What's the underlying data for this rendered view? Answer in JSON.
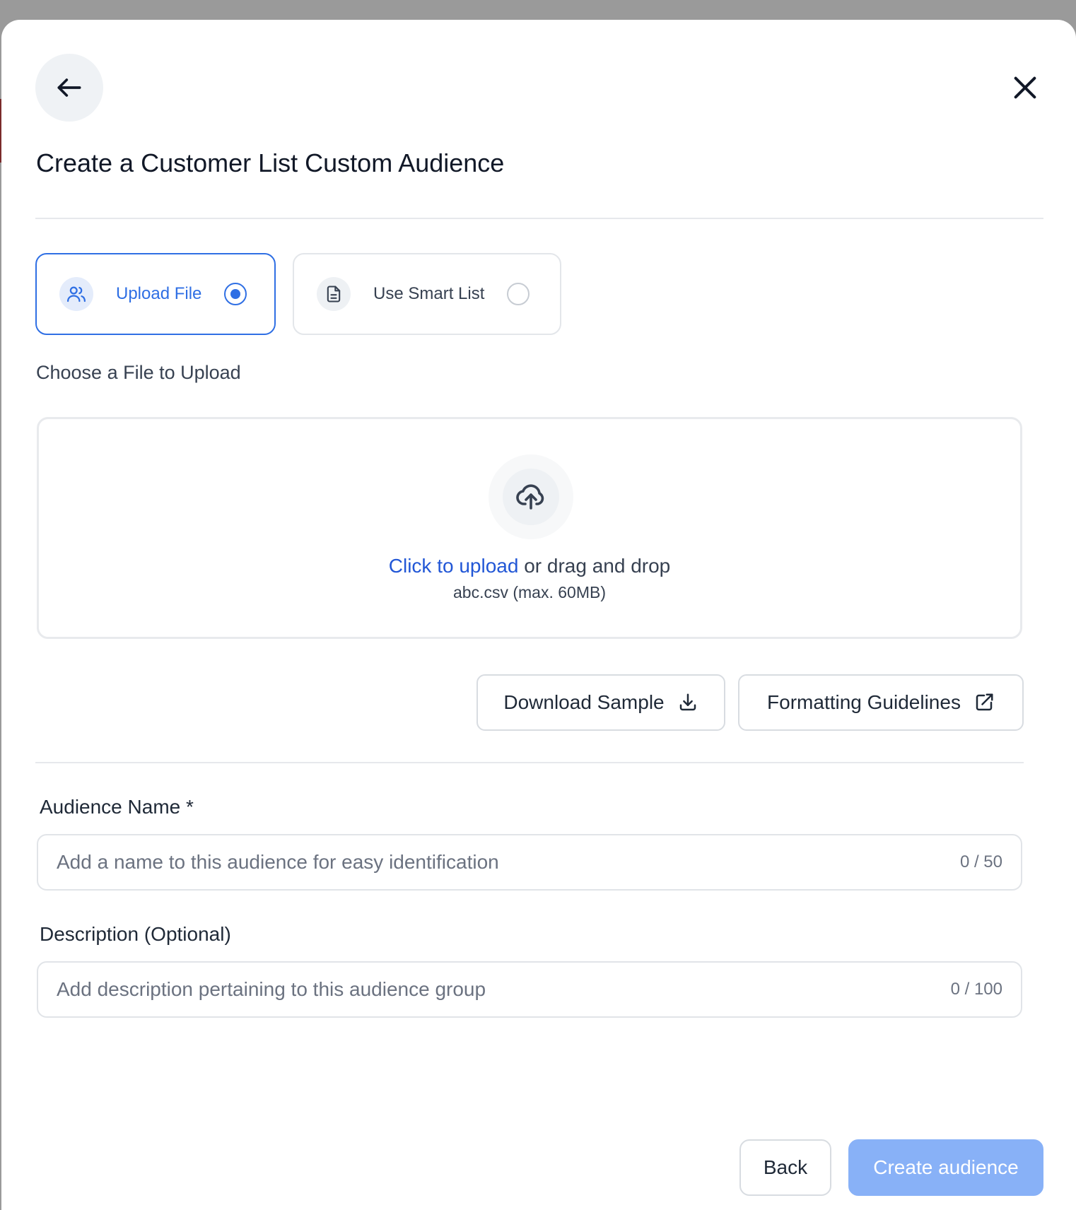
{
  "modal": {
    "title": "Create a Customer List Custom Audience"
  },
  "source_options": [
    {
      "label": "Upload File",
      "icon": "users-icon",
      "selected": true
    },
    {
      "label": "Use Smart List",
      "icon": "document-icon",
      "selected": false
    }
  ],
  "upload": {
    "section_label": "Choose a File to Upload",
    "link_text": "Click to upload",
    "rest_text": " or drag and drop",
    "hint": "abc.csv (max. 60MB)"
  },
  "buttons": {
    "download_sample": "Download Sample",
    "formatting_guidelines": "Formatting Guidelines",
    "back": "Back",
    "create": "Create audience"
  },
  "fields": {
    "audience_name": {
      "label": "Audience Name *",
      "value": "",
      "placeholder": "Add a name to this audience for easy identification",
      "counter": "0 / 50"
    },
    "description": {
      "label": "Description (Optional)",
      "value": "",
      "placeholder": "Add description pertaining to this audience group",
      "counter": "0 / 100"
    }
  },
  "colors": {
    "accent": "#2f6fe4",
    "link": "#2257d6",
    "primary_disabled": "#88b1f7",
    "icon_bg": "#e4ecfb"
  }
}
